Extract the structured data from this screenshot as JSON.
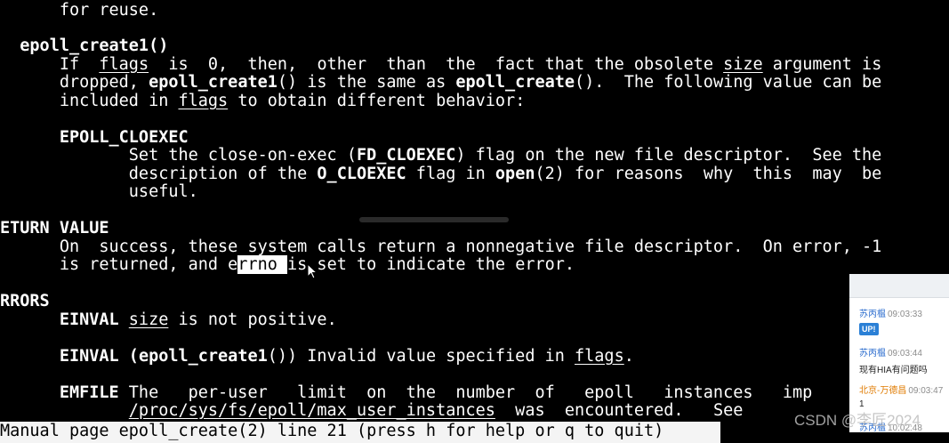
{
  "man": {
    "l01": "      for reuse.",
    "l02": "  epoll_create1()",
    "l03a": "      If  ",
    "l03b": "flags",
    "l03c": "  is  0,  then,  other  than  the  fact that the obsolete ",
    "l03d": "size",
    "l03e": " argument is",
    "l04a": "      dropped, ",
    "l04b": "epoll_create1",
    "l04c": "() is the same as ",
    "l04d": "epoll_create",
    "l04e": "().  The following value can be",
    "l05a": "      included in ",
    "l05b": "flags",
    "l05c": " to obtain different behavior:",
    "l06": "      EPOLL_CLOEXEC",
    "l07a": "             Set the close-on-exec (",
    "l07b": "FD_CLOEXEC",
    "l07c": ") flag on the new file descriptor.  See the",
    "l08a": "             description of the ",
    "l08b": "O_CLOEXEC",
    "l08c": " flag in ",
    "l08d": "open",
    "l08e": "(2) for reasons  why  this  may  be",
    "l09": "             useful.",
    "l10": "ETURN VALUE",
    "l11": "      On  success, these system calls return a nonnegative file descriptor.  On error, -1",
    "l12a": "      is returned, and e",
    "l12b": "rrno ",
    "l12c": "is set to indicate the error.",
    "l13": "RRORS",
    "l14a": "      EINVAL ",
    "l14b": "size",
    "l14c": " is not positive.",
    "l15a": "      EINVAL (",
    "l15b": "epoll_create1",
    "l15c": "()) Invalid value specified in ",
    "l15d": "flags",
    "l15e": ".",
    "l16a": "      EMFILE",
    "l16b": " The   per-user   limit  on  the  number  of   epoll   instances   imp",
    "l17a": "             ",
    "l17b": "/proc/sys/fs/epoll/max_user_instances",
    "l17c": "  was  encountered.   See  ",
    "status": "Manual page epoll_create(2) line 21 (press h for help or q to quit)"
  },
  "chat": {
    "messages": [
      {
        "name": "苏丙榅",
        "time": "09:03:33",
        "badge": "UP!"
      },
      {
        "name": "苏丙榅",
        "time": "09:03:44",
        "text": "现有HIA有问题吗"
      },
      {
        "name": "北京-万德昌",
        "time": "09:03:47",
        "text": "1"
      },
      {
        "name": "苏丙榅",
        "time": "10:02:48"
      }
    ]
  },
  "watermark": "CSDN @李匠2024",
  "colors": {
    "background": "#000000",
    "text": "#ffffff",
    "status_bg": "#f4f4f4",
    "chat_name": "#2f6fcf",
    "chat_name_alt": "#e07b00"
  }
}
